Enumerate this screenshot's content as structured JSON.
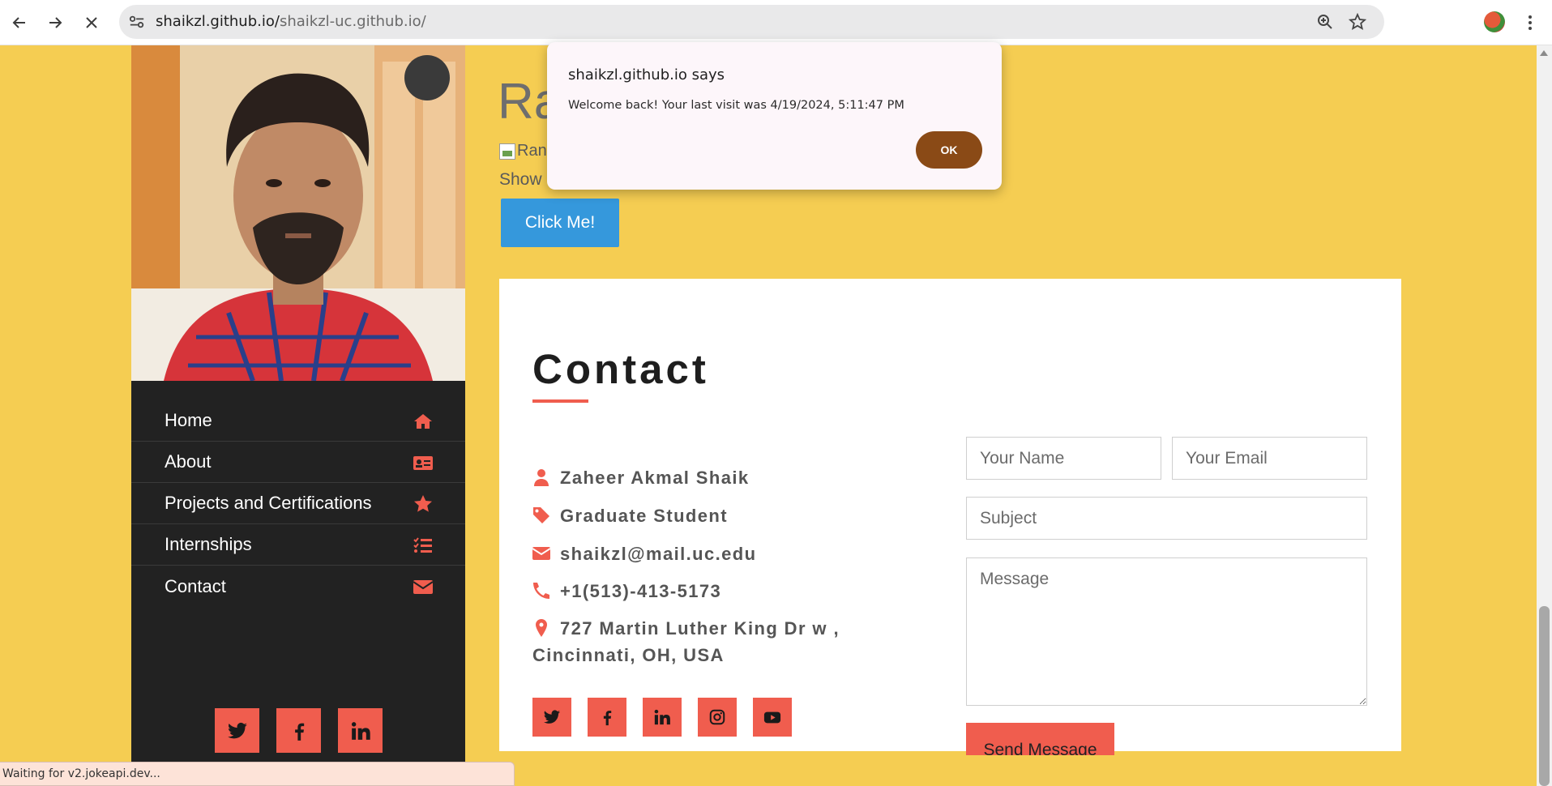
{
  "browser": {
    "url_host": "shaikzl.github.io/",
    "url_path": "shaikzl-uc.github.io/",
    "status_text": "Waiting for v2.jokeapi.dev..."
  },
  "page": {
    "heading_partial": "Ra",
    "broken_image_alt": "Ran",
    "show_text": "Show",
    "click_button": "Click Me!"
  },
  "sidebar": {
    "nav": [
      {
        "label": "Home",
        "icon": "home-icon"
      },
      {
        "label": "About",
        "icon": "id-card-icon"
      },
      {
        "label": "Projects and Certifications",
        "icon": "star-icon"
      },
      {
        "label": "Internships",
        "icon": "tasks-icon"
      },
      {
        "label": "Contact",
        "icon": "envelope-icon"
      }
    ],
    "social": [
      "twitter",
      "facebook",
      "linkedin"
    ]
  },
  "contact": {
    "title": "Contact",
    "name": "Zaheer Akmal Shaik",
    "role": "Graduate Student",
    "email": "shaikzl@mail.uc.edu",
    "phone": "+1(513)-413-5173",
    "address_line1": "727 Martin Luther King Dr w ,",
    "address_line2": "Cincinnati, OH, USA",
    "social": [
      "twitter",
      "facebook",
      "linkedin",
      "instagram",
      "youtube"
    ],
    "form": {
      "name_placeholder": "Your Name",
      "email_placeholder": "Your Email",
      "subject_placeholder": "Subject",
      "message_placeholder": "Message",
      "send_label": "Send Message"
    }
  },
  "dialog": {
    "title": "shaikzl.github.io says",
    "message": "Welcome back! Your last visit was 4/19/2024, 5:11:47 PM",
    "ok_label": "OK"
  },
  "colors": {
    "page_bg": "#f5cd52",
    "accent": "#f05d4e",
    "sidebar_bg": "#222222",
    "button_blue": "#3598dc",
    "ok_button": "#8a4a16"
  }
}
